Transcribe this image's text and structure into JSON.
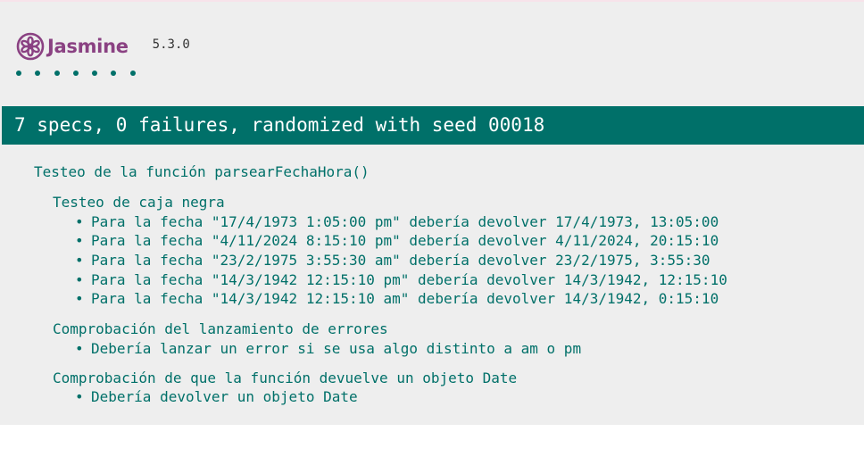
{
  "app": {
    "name": "Jasmine",
    "version": "5.3.0",
    "brand_color": "#8a4182",
    "accent_color": "#007069"
  },
  "symbols": {
    "passed_count": 7,
    "status": "passed"
  },
  "summary": {
    "text": "7 specs, 0 failures, randomized with seed 00018"
  },
  "suites": {
    "root": {
      "title": "Testeo de la función parsearFechaHora()",
      "children": [
        {
          "title": "Testeo de caja negra",
          "specs": [
            "Para la fecha \"17/4/1973 1:05:00 pm\" debería devolver 17/4/1973, 13:05:00",
            "Para la fecha \"4/11/2024 8:15:10 pm\" debería devolver 4/11/2024, 20:15:10",
            "Para la fecha \"23/2/1975 3:55:30 am\" debería devolver 23/2/1975, 3:55:30",
            "Para la fecha \"14/3/1942 12:15:10 pm\" debería devolver 14/3/1942, 12:15:10",
            "Para la fecha \"14/3/1942 12:15:10 am\" debería devolver 14/3/1942, 0:15:10"
          ]
        },
        {
          "title": "Comprobación del lanzamiento de errores",
          "specs": [
            "Debería lanzar un error si se usa algo distinto a am o pm"
          ]
        },
        {
          "title": "Comprobación de que la función devuelve un objeto Date",
          "specs": [
            "Debería devolver un objeto Date"
          ]
        }
      ]
    }
  }
}
